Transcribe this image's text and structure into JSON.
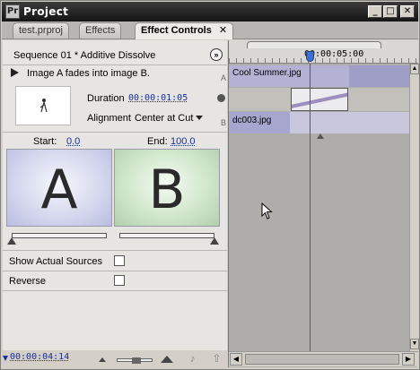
{
  "window": {
    "title": "Project",
    "app_icon": "premiere-icon",
    "min": "_",
    "max": "□",
    "close": "✕"
  },
  "tabs": [
    {
      "label": "test.prproj"
    },
    {
      "label": "Effects"
    },
    {
      "label": "Effect Controls",
      "close": "✕"
    }
  ],
  "effect": {
    "header": "Sequence 01 * Additive Dissolve",
    "menu_glyph": "»",
    "description": "Image A fades into image B.",
    "duration_label": "Duration",
    "duration_value": "00:00:01:05",
    "alignment_label": "Alignment",
    "alignment_value": "Center at Cut",
    "start_label": "Start:",
    "start_value": "0.0",
    "end_label": "End:",
    "end_value": "100.0",
    "preview_a": "A",
    "preview_b": "B",
    "start_slider": 0.0,
    "end_slider": 1.0,
    "options": [
      {
        "label": "Show Actual Sources",
        "checked": false
      },
      {
        "label": "Reverse",
        "checked": false
      }
    ]
  },
  "bottom": {
    "timecode": "00:00:04:14",
    "zoom_level": 0.55
  },
  "timeline": {
    "ruler_timecode": "00:00:05:00",
    "track_a_label": "A",
    "track_b_label": "B",
    "clip_a": "Cool Summer.jpg",
    "clip_b": "dc003.jpg"
  },
  "colors": {
    "timecode_blue": "#1a2e9a",
    "playhead_red": "#e02020",
    "clip_purple": "#b3b2d5"
  }
}
